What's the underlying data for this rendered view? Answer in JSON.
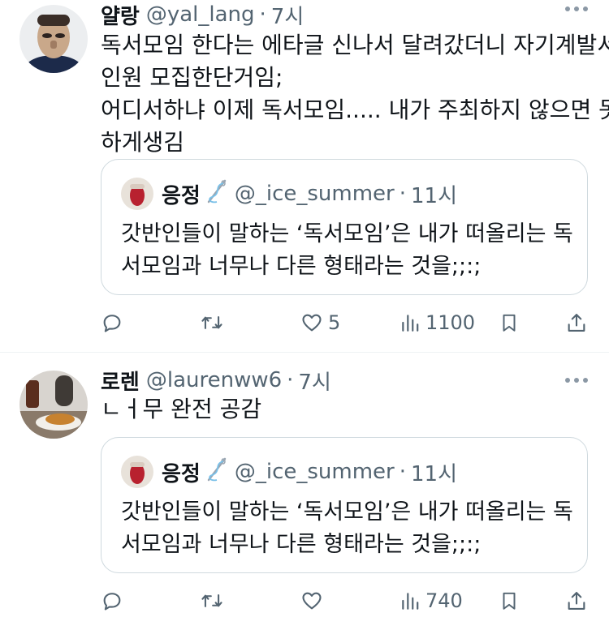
{
  "tweets": [
    {
      "author_name": "얄랑",
      "author_handle": "@yal_lang",
      "separator": "·",
      "time": "7시",
      "lines": [
        "독서모임 한다는 에타글 신나서 달려갔더니 자기계발서",
        "인원 모집한단거임;",
        "어디서하냐 이제 독서모임..... 내가 주최하지 않으면 못",
        "하게생김"
      ],
      "quote": {
        "author_name": "응정",
        "author_handle": "@_ice_summer",
        "separator": "·",
        "time": "11시",
        "lines": [
          "갓반인들이 말하는 ‘독서모임’은 내가 떠올리는 독",
          "서모임과 너무나 다른 형태라는 것을;;:;"
        ]
      },
      "stats": {
        "replies": "",
        "retweets": "",
        "likes": "5",
        "views": "1100"
      }
    },
    {
      "author_name": "로렌",
      "author_handle": "@laurenww6",
      "separator": "·",
      "time": "7시",
      "lines": [
        "ㄴㅓ무 완전 공감"
      ],
      "quote": {
        "author_name": "응정",
        "author_handle": "@_ice_summer",
        "separator": "·",
        "time": "11시",
        "lines": [
          "갓반인들이 말하는 ‘독서모임’은 내가 떠올리는 독",
          "서모임과 너무나 다른 형태라는 것을;;:;"
        ]
      },
      "stats": {
        "replies": "",
        "retweets": "",
        "likes": "",
        "views": "740"
      }
    }
  ],
  "icons": [
    "reply-icon",
    "retweet-icon",
    "like-icon",
    "views-icon",
    "bookmark-icon",
    "share-icon",
    "more-icon"
  ],
  "colors": {
    "text": "#0f1419",
    "secondary": "#536471",
    "border": "#cfd9de",
    "divider": "#eff3f4"
  }
}
